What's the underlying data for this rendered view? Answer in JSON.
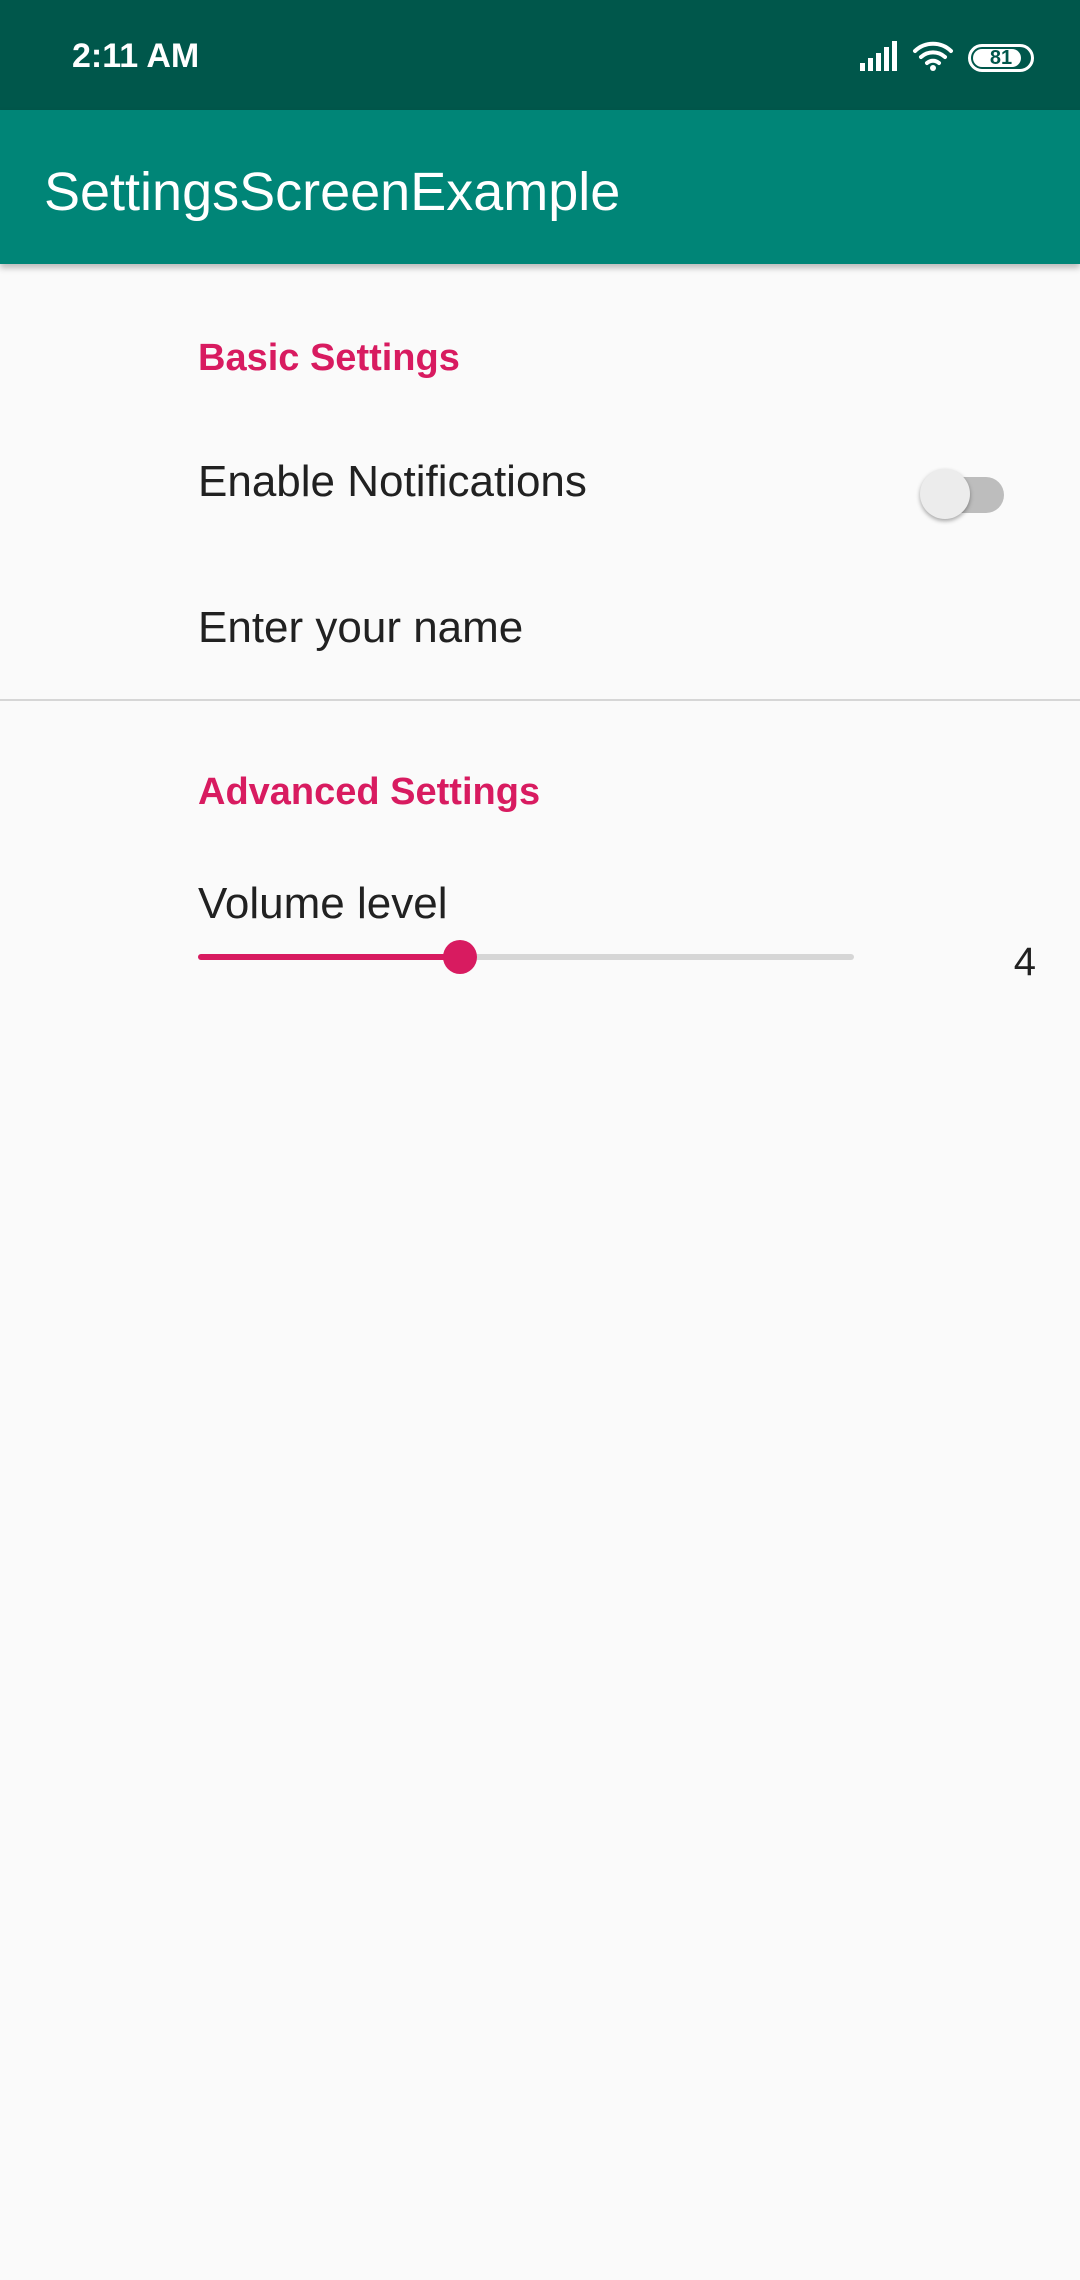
{
  "status_bar": {
    "time": "2:11 AM",
    "battery_level": "81",
    "icons": [
      "signal-icon",
      "wifi-icon",
      "battery-icon"
    ]
  },
  "app_bar": {
    "title": "SettingsScreenExample"
  },
  "basic_settings": {
    "header": "Basic Settings",
    "notifications": {
      "label": "Enable Notifications",
      "enabled": false
    },
    "name": {
      "label": "Enter your name"
    }
  },
  "advanced_settings": {
    "header": "Advanced Settings",
    "volume": {
      "label": "Volume level",
      "value": "4",
      "fill_fraction": 0.4
    }
  },
  "colors": {
    "status_bar": "#00574b",
    "app_bar": "#008577",
    "accent": "#d81b60",
    "background": "#fafafa"
  }
}
